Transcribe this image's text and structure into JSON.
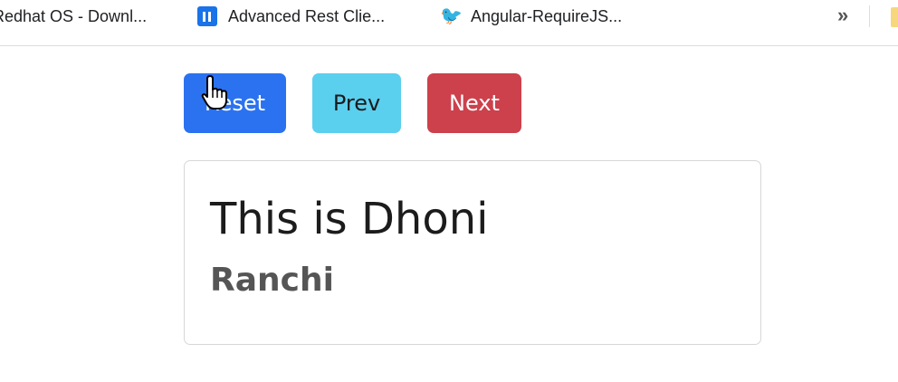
{
  "bookmarks": [
    {
      "label": "Redhat OS - Downl...",
      "icon": "redhat-icon"
    },
    {
      "label": "Advanced Rest Clie...",
      "icon": "app-icon"
    },
    {
      "label": "Angular-RequireJS...",
      "icon": "bird-icon"
    }
  ],
  "overflow_label": "»",
  "buttons": {
    "reset": "Reset",
    "prev": "Prev",
    "next": "Next"
  },
  "card": {
    "title": "This is Dhoni",
    "subtitle": "Ranchi"
  },
  "colors": {
    "reset": "#2b72f0",
    "prev": "#5bcfee",
    "next": "#cc414c"
  }
}
